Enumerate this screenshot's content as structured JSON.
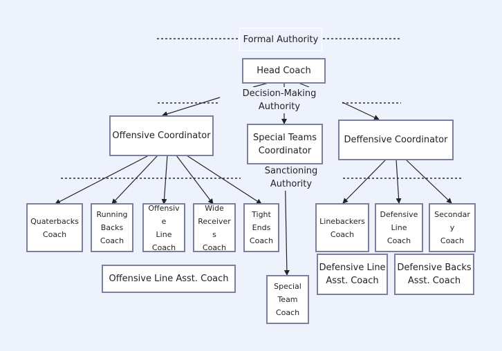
{
  "diagram": {
    "formal_authority": [
      "Formal Authority"
    ],
    "head_coach": [
      "Head Coach"
    ],
    "decision_making": [
      "Decision-Making",
      "Authority"
    ],
    "offensive_coordinator": [
      "Offensive Coordinator"
    ],
    "special_teams_coordinator": [
      "Special Teams",
      "Coordinator"
    ],
    "defensive_coordinator": [
      "Deffensive Coordinator"
    ],
    "sanctioning": [
      "Sanctioning",
      "Authority"
    ],
    "quarterbacks": [
      "Quaterbacks",
      "Coach"
    ],
    "running_backs": [
      "Running",
      "Backs",
      "Coach"
    ],
    "offensive_line": [
      "Offensiv",
      "e",
      "Line",
      "Coach"
    ],
    "wide_receivers": [
      "Wide",
      "Receiver",
      "s",
      "Coach"
    ],
    "tight_ends": [
      "Tight",
      "Ends",
      "Coach"
    ],
    "ol_asst": [
      "Offensive Line Asst. Coach"
    ],
    "special_team_coach": [
      "Special",
      "Team",
      "Coach"
    ],
    "linebackers": [
      "Linebackers",
      "Coach"
    ],
    "defensive_line": [
      "Defensive",
      "Line",
      "Coach"
    ],
    "secondary": [
      "Secondar",
      "y",
      "Coach"
    ],
    "dl_asst": [
      "Defensive Line",
      "Asst. Coach"
    ],
    "db_asst": [
      "Defensive Backs",
      "Asst. Coach"
    ]
  },
  "colors": {
    "background": "#edf2fd",
    "box_border": "#7b7f9c",
    "line": "#222222",
    "dash": "#555a6e"
  }
}
